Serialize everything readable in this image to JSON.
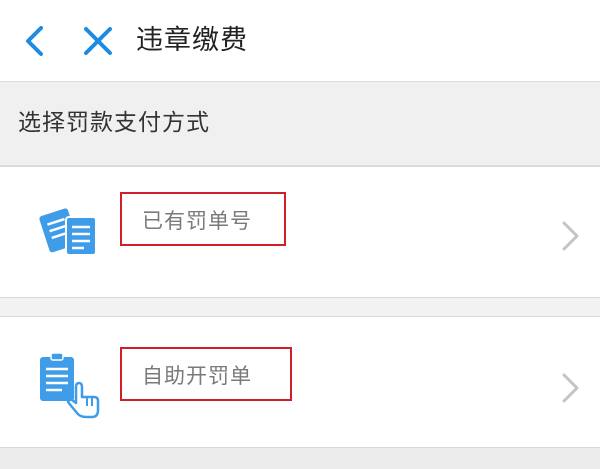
{
  "header": {
    "back_icon": "chevron-left-icon",
    "close_icon": "close-icon",
    "title": "违章缴费",
    "accent_color": "#1e8be0"
  },
  "subheader": {
    "text": "选择罚款支付方式"
  },
  "options": [
    {
      "label": "已有罚单号",
      "icon": "documents-icon",
      "highlight_color": "#d01f28"
    },
    {
      "label": "自助开罚单",
      "icon": "document-tap-icon",
      "highlight_color": "#d01f28"
    }
  ]
}
